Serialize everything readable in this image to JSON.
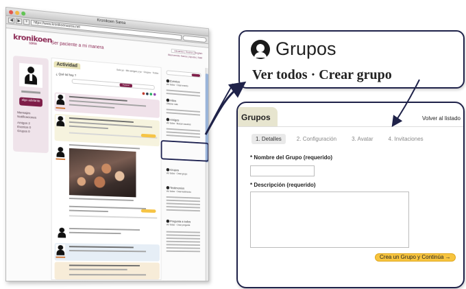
{
  "browser": {
    "window_title": "Kronikoen Sarea",
    "url": "https://www.kronikoensarea.net",
    "back_label": "◀",
    "forward_label": "▶",
    "add_label": "+"
  },
  "site": {
    "logo": "kronikoen",
    "logo_sub": "sarea",
    "tagline": "Ser paciente a mi manera",
    "toplinks": [
      "Usuarios | Suena | English",
      "Bienvenido Sarea | Ayuda | Salir"
    ],
    "sidebar": {
      "say_button": "algo adelante",
      "links": [
        "Mensajes",
        "Notificaciones",
        "Amigos 2",
        "Eventos 0",
        "Grupos 0"
      ]
    },
    "activity": {
      "tab": "Actividad",
      "filter": "Solo yo · Mis amigos y yo · Grupos · Todos",
      "whats_up": "¿ Qué tal hay ?",
      "publish": "Publicar"
    },
    "rightcol": {
      "blocks": [
        {
          "title": "Eventos",
          "sub": "Ver todos · Crear evento"
        },
        {
          "title": "Hitos",
          "sub": "Obtener más"
        },
        {
          "title": "Amigos",
          "sub": "Ver todos · Buscar usuarios"
        },
        {
          "title": "Grupos",
          "sub": "Ver todos · Crear grupo"
        },
        {
          "title": "Testimonios",
          "sub": "Ver todos · Crear testimonio"
        },
        {
          "title": "Pregunta a todos",
          "sub": "Ver todas · Crear pregunta"
        }
      ]
    }
  },
  "callout_groups": {
    "title": "Grupos",
    "links": "Ver todos · Crear grupo"
  },
  "create_group": {
    "tab_title": "Grupos",
    "back_link": "Volver al listado",
    "steps": [
      "1. Detalles",
      "2. Configuración",
      "3. Avatar",
      "4. Invitaciones"
    ],
    "name_label": "* Nombre del Grupo (requerido)",
    "description_label": "* Descripción (requerido)",
    "submit_button": "Crea un Grupo y Continúa →"
  },
  "colors": {
    "brand": "#8c2a55",
    "outline": "#1f2249",
    "button_yellow": "#f7c43f",
    "activity_dots": [
      "#c0392b",
      "#2c3e50",
      "#27ae60",
      "#8e44ad"
    ]
  }
}
